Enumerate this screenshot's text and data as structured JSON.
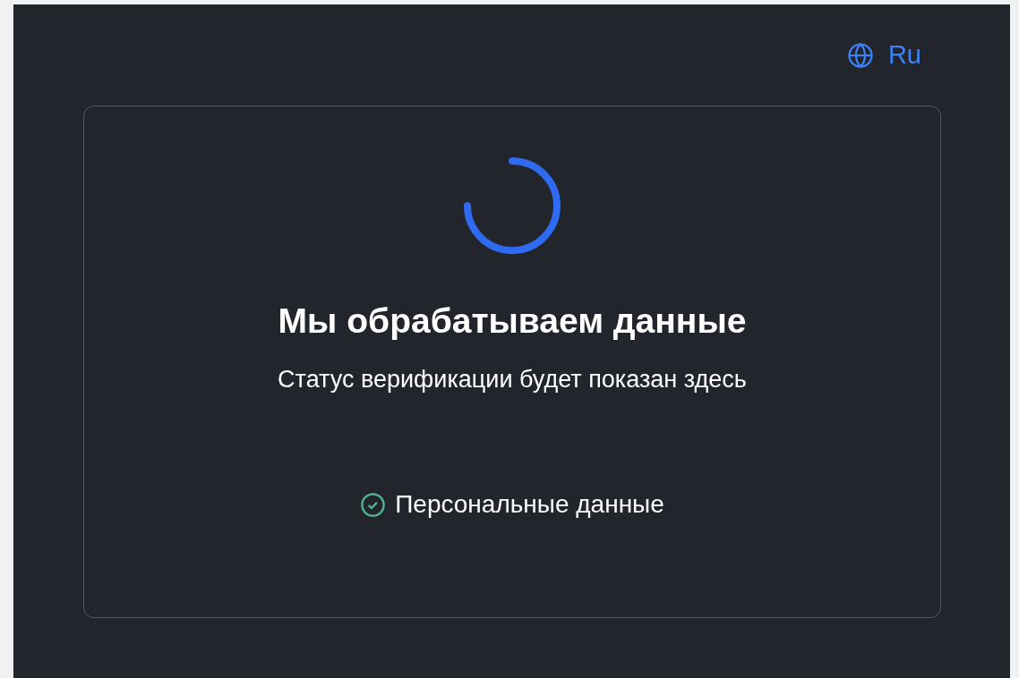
{
  "language": {
    "label": "Ru"
  },
  "status": {
    "title": "Мы обрабатываем данные",
    "subtitle": "Статус верификации будет показан здесь"
  },
  "steps": [
    {
      "label": "Персональные данные",
      "done": true
    }
  ]
}
